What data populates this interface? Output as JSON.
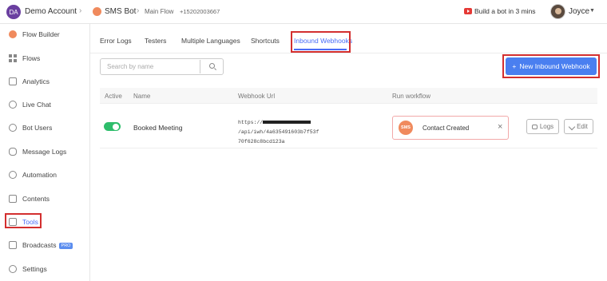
{
  "topbar": {
    "account_initials": "DA",
    "account_name": "Demo Account",
    "bot_name": "SMS Bot",
    "flow_name": "Main Flow",
    "phone": "+15202003667",
    "build_link": "Build a bot in 3 mins",
    "user_name": "Joyce"
  },
  "sidebar": {
    "items": [
      {
        "label": "Flow Builder",
        "icon": "flow-builder-icon"
      },
      {
        "label": "Flows",
        "icon": "grid-icon"
      },
      {
        "label": "Analytics",
        "icon": "analytics-icon"
      },
      {
        "label": "Live Chat",
        "icon": "headset-icon"
      },
      {
        "label": "Bot Users",
        "icon": "user-icon"
      },
      {
        "label": "Message Logs",
        "icon": "database-icon"
      },
      {
        "label": "Automation",
        "icon": "automation-icon"
      },
      {
        "label": "Contents",
        "icon": "contents-icon"
      },
      {
        "label": "Tools",
        "icon": "tools-icon"
      },
      {
        "label": "Broadcasts",
        "icon": "megaphone-icon",
        "badge": "PRO"
      },
      {
        "label": "Settings",
        "icon": "gear-icon"
      }
    ]
  },
  "tabs": [
    "Error Logs",
    "Testers",
    "Multiple Languages",
    "Shortcuts",
    "Inbound Webhooks"
  ],
  "active_tab": "Inbound Webhooks",
  "search": {
    "placeholder": "Search by name"
  },
  "new_button": {
    "label": "New Inbound Webhook",
    "icon": "plus-icon"
  },
  "table": {
    "headers": [
      "Active",
      "Name",
      "Webhook Url",
      "Run workflow"
    ],
    "rows": [
      {
        "active": true,
        "name": "Booked Meeting",
        "url_prefix": "https://",
        "url_suffix": "/api/iwh/4a635491603b7f53f",
        "url_line2": "70f628c8bcd123a",
        "workflow": {
          "logo_text": "SMS",
          "label": "Contact Created"
        },
        "logs_label": "Logs",
        "edit_label": "Edit"
      }
    ]
  },
  "colors": {
    "accent": "#4a7ff0",
    "highlight": "#d32f2f",
    "toggle_on": "#2ebd6b"
  }
}
